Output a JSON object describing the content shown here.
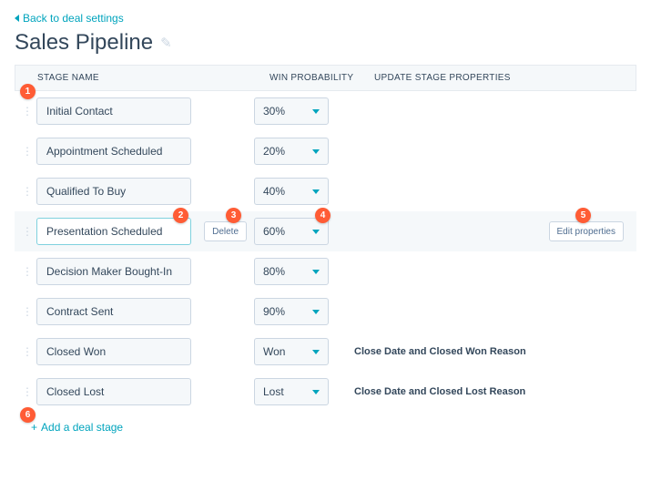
{
  "nav": {
    "back_label": "Back to deal settings"
  },
  "page": {
    "title": "Sales Pipeline"
  },
  "columns": {
    "stage_name": "STAGE NAME",
    "win_probability": "WIN PROBABILITY",
    "update_stage_properties": "UPDATE STAGE PROPERTIES"
  },
  "buttons": {
    "delete": "Delete",
    "edit_properties": "Edit properties"
  },
  "stages": {
    "s0": {
      "name": "Initial Contact",
      "probability": "30%",
      "update_text": ""
    },
    "s1": {
      "name": "Appointment Scheduled",
      "probability": "20%",
      "update_text": ""
    },
    "s2": {
      "name": "Qualified To Buy",
      "probability": "40%",
      "update_text": ""
    },
    "s3": {
      "name": "Presentation Scheduled",
      "probability": "60%",
      "update_text": ""
    },
    "s4": {
      "name": "Decision Maker Bought-In",
      "probability": "80%",
      "update_text": ""
    },
    "s5": {
      "name": "Contract Sent",
      "probability": "90%",
      "update_text": ""
    },
    "s6": {
      "name": "Closed Won",
      "probability": "Won",
      "update_text": "Close Date and Closed Won Reason"
    },
    "s7": {
      "name": "Closed Lost",
      "probability": "Lost",
      "update_text": "Close Date and Closed Lost Reason"
    }
  },
  "add_stage": {
    "label": "Add a deal stage"
  },
  "annotations": {
    "a1": "1",
    "a2": "2",
    "a3": "3",
    "a4": "4",
    "a5": "5",
    "a6": "6"
  }
}
